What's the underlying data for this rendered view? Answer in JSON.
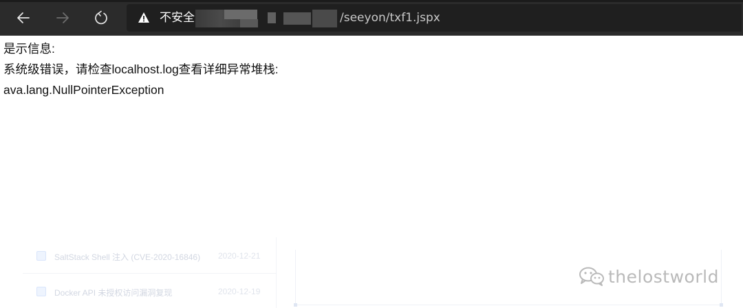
{
  "browser": {
    "security_label": "不安全",
    "url_path": "/seeyon/txf1.jspx"
  },
  "page": {
    "lines": [
      "是示信息:",
      "系统级错误，请检查localhost.log查看详细异常堆栈:",
      "ava.lang.NullPointerException"
    ]
  },
  "background_list": {
    "items": [
      {
        "title": "SaltStack Shell 注入 (CVE-2020-16846)",
        "date": "2020-12-21"
      },
      {
        "title": "Docker API 未授权访问漏洞复现",
        "date": "2020-12-19"
      }
    ]
  },
  "watermark": {
    "text": "thelostworld",
    "icon": "wechat-icon"
  }
}
